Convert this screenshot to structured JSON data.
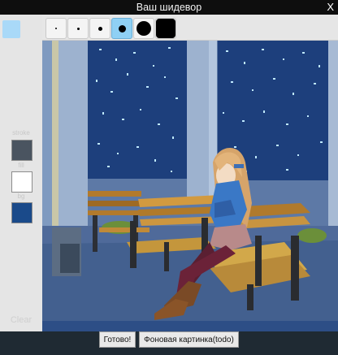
{
  "window": {
    "title": "Ваш шидевор",
    "close_label": "X"
  },
  "sidebar": {
    "current_color": "#a9d9f8",
    "stroke_label": "stroke",
    "stroke_color": "#4a5460",
    "fill_label": "fill",
    "fill_color": "#ffffff",
    "bg_label": "bg",
    "bg_color": "#1a4a8a",
    "clear_label": "Clear"
  },
  "brushes": {
    "sizes": [
      "tiny",
      "small",
      "medium",
      "large",
      "x-large",
      "xx-large"
    ],
    "selected": "large"
  },
  "footer": {
    "done_label": "Готово!",
    "background_label": "Фоновая картинка(todo)"
  }
}
